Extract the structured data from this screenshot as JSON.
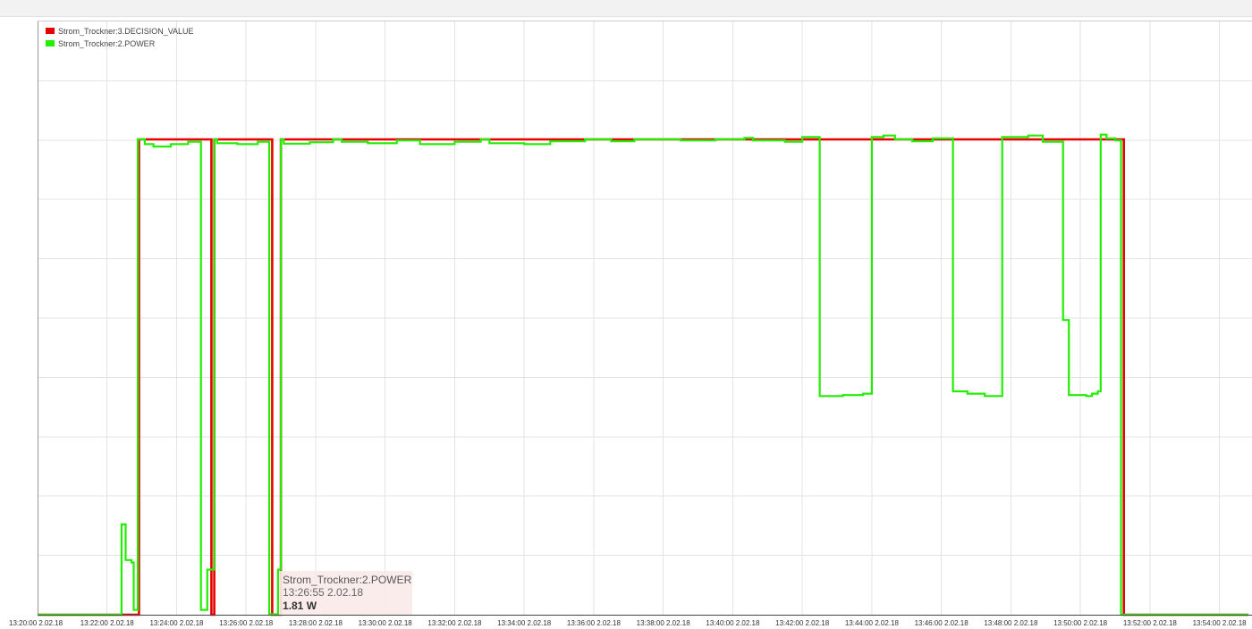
{
  "chart_data": {
    "type": "line",
    "step": true,
    "grid": true,
    "legend_position": "top-left",
    "x_tick_labels": [
      "13:20:00 2.02.18",
      "13:22:00 2.02.18",
      "13:24:00 2.02.18",
      "13:26:00 2.02.18",
      "13:28:00 2.02.18",
      "13:30:00 2.02.18",
      "13:32:00 2.02.18",
      "13:34:00 2.02.18",
      "13:36:00 2.02.18",
      "13:38:00 2.02.18",
      "13:40:00 2.02.18",
      "13:42:00 2.02.18",
      "13:44:00 2.02.18",
      "13:46:00 2.02.18",
      "13:48:00 2.02.18",
      "13:50:00 2.02.18",
      "13:52:00 2.02.18",
      "13:54:00 2.02.18"
    ],
    "x_range": [
      "13:20:00",
      "13:54:50"
    ],
    "y_range": [
      0,
      1
    ],
    "series": [
      {
        "name": "Strom_Trockner:3.DECISION_VALUE",
        "color": "#e60000",
        "points": [
          [
            "13:20:00",
            0
          ],
          [
            "13:22:55",
            0
          ],
          [
            "13:22:55",
            1
          ],
          [
            "13:25:00",
            1
          ],
          [
            "13:25:00",
            0
          ],
          [
            "13:25:05",
            0
          ],
          [
            "13:25:05",
            1
          ],
          [
            "13:26:45",
            1
          ],
          [
            "13:26:45",
            0
          ],
          [
            "13:27:00",
            0
          ],
          [
            "13:27:00",
            1
          ],
          [
            "13:51:15",
            1
          ],
          [
            "13:51:15",
            0
          ],
          [
            "13:54:50",
            0
          ]
        ]
      },
      {
        "name": "Strom_Trockner:2.POWER",
        "color": "#22ee00",
        "points": [
          [
            "13:20:00",
            0
          ],
          [
            "13:22:25",
            0
          ],
          [
            "13:22:25",
            0.19
          ],
          [
            "13:22:32",
            0.19
          ],
          [
            "13:22:32",
            0.115
          ],
          [
            "13:22:42",
            0.115
          ],
          [
            "13:22:42",
            0.11
          ],
          [
            "13:22:46",
            0.11
          ],
          [
            "13:22:46",
            0.01
          ],
          [
            "13:22:53",
            0.01
          ],
          [
            "13:22:53",
            1
          ],
          [
            "13:23:05",
            1
          ],
          [
            "13:23:05",
            0.99
          ],
          [
            "13:23:20",
            0.99
          ],
          [
            "13:23:20",
            0.985
          ],
          [
            "13:23:50",
            0.985
          ],
          [
            "13:23:50",
            0.99
          ],
          [
            "13:24:20",
            0.99
          ],
          [
            "13:24:20",
            0.995
          ],
          [
            "13:24:42",
            0.995
          ],
          [
            "13:24:42",
            0.01
          ],
          [
            "13:24:53",
            0.01
          ],
          [
            "13:24:53",
            0.095
          ],
          [
            "13:25:05",
            0.095
          ],
          [
            "13:25:05",
            1
          ],
          [
            "13:25:10",
            1
          ],
          [
            "13:25:10",
            0.992
          ],
          [
            "13:25:45",
            0.992
          ],
          [
            "13:25:45",
            0.99
          ],
          [
            "13:26:20",
            0.99
          ],
          [
            "13:26:20",
            0.995
          ],
          [
            "13:26:40",
            0.995
          ],
          [
            "13:26:40",
            0.001
          ],
          [
            "13:26:55",
            0.001
          ],
          [
            "13:26:55",
            0.095
          ],
          [
            "13:27:00",
            0.095
          ],
          [
            "13:27:00",
            1
          ],
          [
            "13:27:05",
            1
          ],
          [
            "13:27:05",
            0.991
          ],
          [
            "13:27:50",
            0.991
          ],
          [
            "13:27:50",
            0.994
          ],
          [
            "13:28:30",
            0.994
          ],
          [
            "13:28:30",
            1
          ],
          [
            "13:28:45",
            1
          ],
          [
            "13:28:45",
            0.995
          ],
          [
            "13:29:30",
            0.995
          ],
          [
            "13:29:30",
            0.992
          ],
          [
            "13:30:20",
            0.992
          ],
          [
            "13:30:20",
            0.998
          ],
          [
            "13:31:00",
            0.998
          ],
          [
            "13:31:00",
            0.99
          ],
          [
            "13:32:00",
            0.99
          ],
          [
            "13:32:00",
            0.995
          ],
          [
            "13:32:45",
            0.995
          ],
          [
            "13:32:45",
            1
          ],
          [
            "13:33:00",
            1
          ],
          [
            "13:33:00",
            0.992
          ],
          [
            "13:34:00",
            0.992
          ],
          [
            "13:34:00",
            0.99
          ],
          [
            "13:34:45",
            0.99
          ],
          [
            "13:34:45",
            0.996
          ],
          [
            "13:35:45",
            0.996
          ],
          [
            "13:35:45",
            1
          ],
          [
            "13:36:30",
            1
          ],
          [
            "13:36:30",
            0.996
          ],
          [
            "13:37:10",
            0.996
          ],
          [
            "13:37:10",
            1
          ],
          [
            "13:38:30",
            1
          ],
          [
            "13:38:30",
            0.998
          ],
          [
            "13:39:30",
            0.998
          ],
          [
            "13:39:30",
            1
          ],
          [
            "13:40:20",
            1
          ],
          [
            "13:40:20",
            1.003
          ],
          [
            "13:40:35",
            1.003
          ],
          [
            "13:40:35",
            0.998
          ],
          [
            "13:41:30",
            0.998
          ],
          [
            "13:41:30",
            0.995
          ],
          [
            "13:42:00",
            0.995
          ],
          [
            "13:42:00",
            1.005
          ],
          [
            "13:42:30",
            1.005
          ],
          [
            "13:42:30",
            0.46
          ],
          [
            "13:43:10",
            0.46
          ],
          [
            "13:43:10",
            0.462
          ],
          [
            "13:43:45",
            0.462
          ],
          [
            "13:43:45",
            0.465
          ],
          [
            "13:44:00",
            0.465
          ],
          [
            "13:44:00",
            1.005
          ],
          [
            "13:44:20",
            1.005
          ],
          [
            "13:44:20",
            1.008
          ],
          [
            "13:44:40",
            1.008
          ],
          [
            "13:44:40",
            1
          ],
          [
            "13:45:10",
            1
          ],
          [
            "13:45:10",
            0.996
          ],
          [
            "13:45:45",
            0.996
          ],
          [
            "13:45:45",
            1.002
          ],
          [
            "13:46:20",
            1.002
          ],
          [
            "13:46:20",
            0.47
          ],
          [
            "13:46:45",
            0.47
          ],
          [
            "13:46:45",
            0.465
          ],
          [
            "13:47:15",
            0.465
          ],
          [
            "13:47:15",
            0.46
          ],
          [
            "13:47:45",
            0.46
          ],
          [
            "13:47:45",
            1.005
          ],
          [
            "13:48:30",
            1.005
          ],
          [
            "13:48:30",
            1.008
          ],
          [
            "13:48:55",
            1.008
          ],
          [
            "13:48:55",
            0.995
          ],
          [
            "13:49:30",
            0.995
          ],
          [
            "13:49:30",
            0.62
          ],
          [
            "13:49:40",
            0.62
          ],
          [
            "13:49:40",
            0.462
          ],
          [
            "13:50:10",
            0.462
          ],
          [
            "13:50:10",
            0.46
          ],
          [
            "13:50:20",
            0.46
          ],
          [
            "13:50:20",
            0.465
          ],
          [
            "13:50:30",
            0.465
          ],
          [
            "13:50:30",
            0.47
          ],
          [
            "13:50:35",
            0.47
          ],
          [
            "13:50:35",
            1.01
          ],
          [
            "13:50:45",
            1.01
          ],
          [
            "13:50:45",
            1.002
          ],
          [
            "13:51:00",
            1.002
          ],
          [
            "13:51:00",
            0.998
          ],
          [
            "13:51:10",
            0.998
          ],
          [
            "13:51:10",
            0
          ],
          [
            "13:54:50",
            0
          ]
        ]
      }
    ]
  },
  "tooltip": {
    "series": "Strom_Trockner:2.POWER",
    "time": "13:26:55 2.02.18",
    "value": "1.81 W"
  }
}
